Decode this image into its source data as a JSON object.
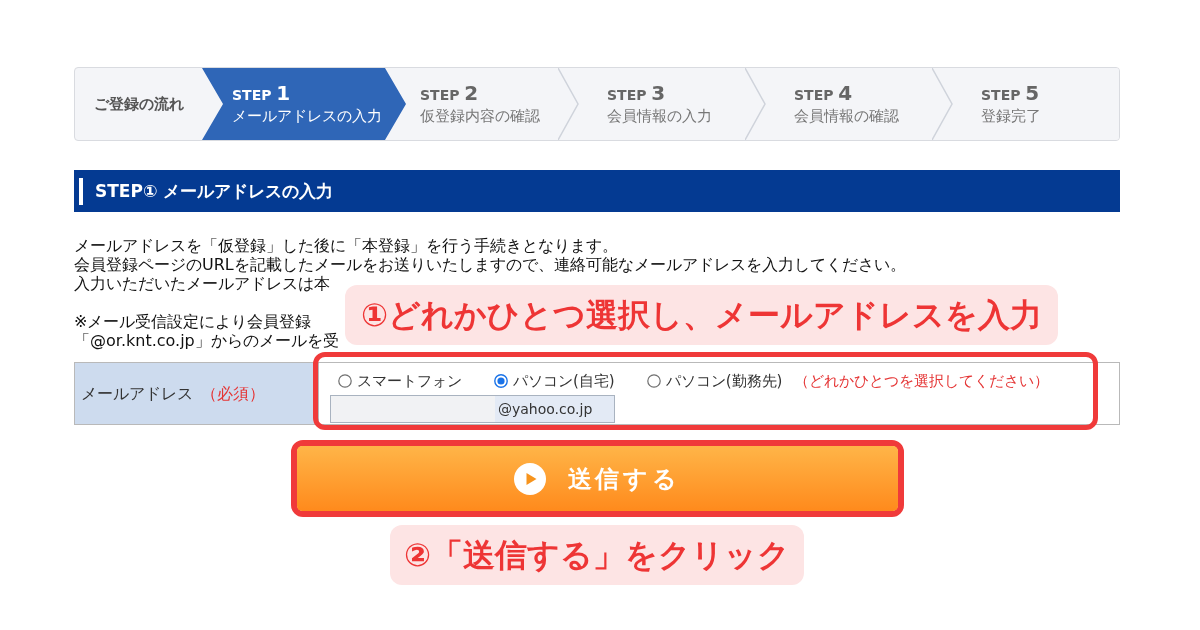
{
  "step_bar": {
    "title": "ご登録の流れ",
    "steps": [
      {
        "label": "STEP",
        "number": "1",
        "title": "メールアドレスの入力",
        "selected": true
      },
      {
        "label": "STEP",
        "number": "2",
        "title": "仮登録内容の確認",
        "selected": false
      },
      {
        "label": "STEP",
        "number": "3",
        "title": "会員情報の入力",
        "selected": false
      },
      {
        "label": "STEP",
        "number": "4",
        "title": "会員情報の確認",
        "selected": false
      },
      {
        "label": "STEP",
        "number": "5",
        "title": "登録完了",
        "selected": false
      }
    ]
  },
  "section_heading": "STEP① メールアドレスの入力",
  "intro_lines": [
    "メールアドレスを「仮登録」した後に「本登録」を行う手続きとなります。",
    "会員登録ページのURLを記載したメールをお送りいたしますので、連絡可能なメールアドレスを入力してください。",
    "入力いただいたメールアドレスは本"
  ],
  "notice_lines": [
    "※メール受信設定により会員登録",
    "「@or.knt.co.jp」からのメールを受"
  ],
  "form": {
    "label": "メールアドレス",
    "required_mark": "（必須）",
    "options": [
      {
        "label": "スマートフォン",
        "selected": false
      },
      {
        "label": "パソコン(自宅)",
        "selected": true
      },
      {
        "label": "パソコン(勤務先)",
        "selected": false
      }
    ],
    "option_hint": "（どれかひとつを選択してください）",
    "email_value": "@yahoo.co.jp"
  },
  "submit_button": {
    "label": "送信する"
  },
  "callouts": [
    {
      "text": "①どれかひとつ選択し、メールアドレスを入力"
    },
    {
      "text": "②「送信する」をクリック"
    }
  ]
}
